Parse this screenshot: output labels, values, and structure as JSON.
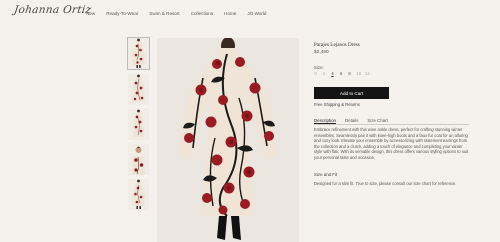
{
  "brand": {
    "logo_text": "Johanna Ortiz"
  },
  "nav": {
    "items": [
      "New",
      "Ready-To-Wear",
      "Swim & Resort",
      "Collections",
      "Home",
      "JO World"
    ]
  },
  "product": {
    "title": "Parajes Lejanos Dress",
    "price": "$2,450",
    "size_label": "Size:",
    "sizes": [
      "0",
      "2",
      "4",
      "6",
      "8",
      "10",
      "12"
    ],
    "selected_size": "4",
    "add_to_cart_label": "Add to Cart",
    "shipping_link": "Free Shipping & Returns",
    "tabs": [
      "Description",
      "Details",
      "Size Chart"
    ],
    "active_tab": "Description",
    "description": "Embrace refinement with this wine ankle dress, perfect for crafting stunning winter ensembles. Seamlessly pair it with knee-high boots and a faux fur coat for an alluring and cozy look. Elevate your ensemble by accessorizing with statement earrings from the collection and a clutch, adding a touch of elegance and completing your winter style with flair. With its versatile design, this dress offers various styling options to suit your personal taste and occasion.",
    "fit_heading": "Size and Fit",
    "fit_text": "Designed for a slim fit. True to size, please consult our size chart for reference."
  },
  "gallery": {
    "thumbnail_count": 5,
    "active_index": 0
  },
  "colors": {
    "background": "#f5f2ee",
    "button": "#141414",
    "dress_base": "#efe4d6",
    "flower_red": "#9a1c22",
    "stem_black": "#1a1a1a"
  }
}
